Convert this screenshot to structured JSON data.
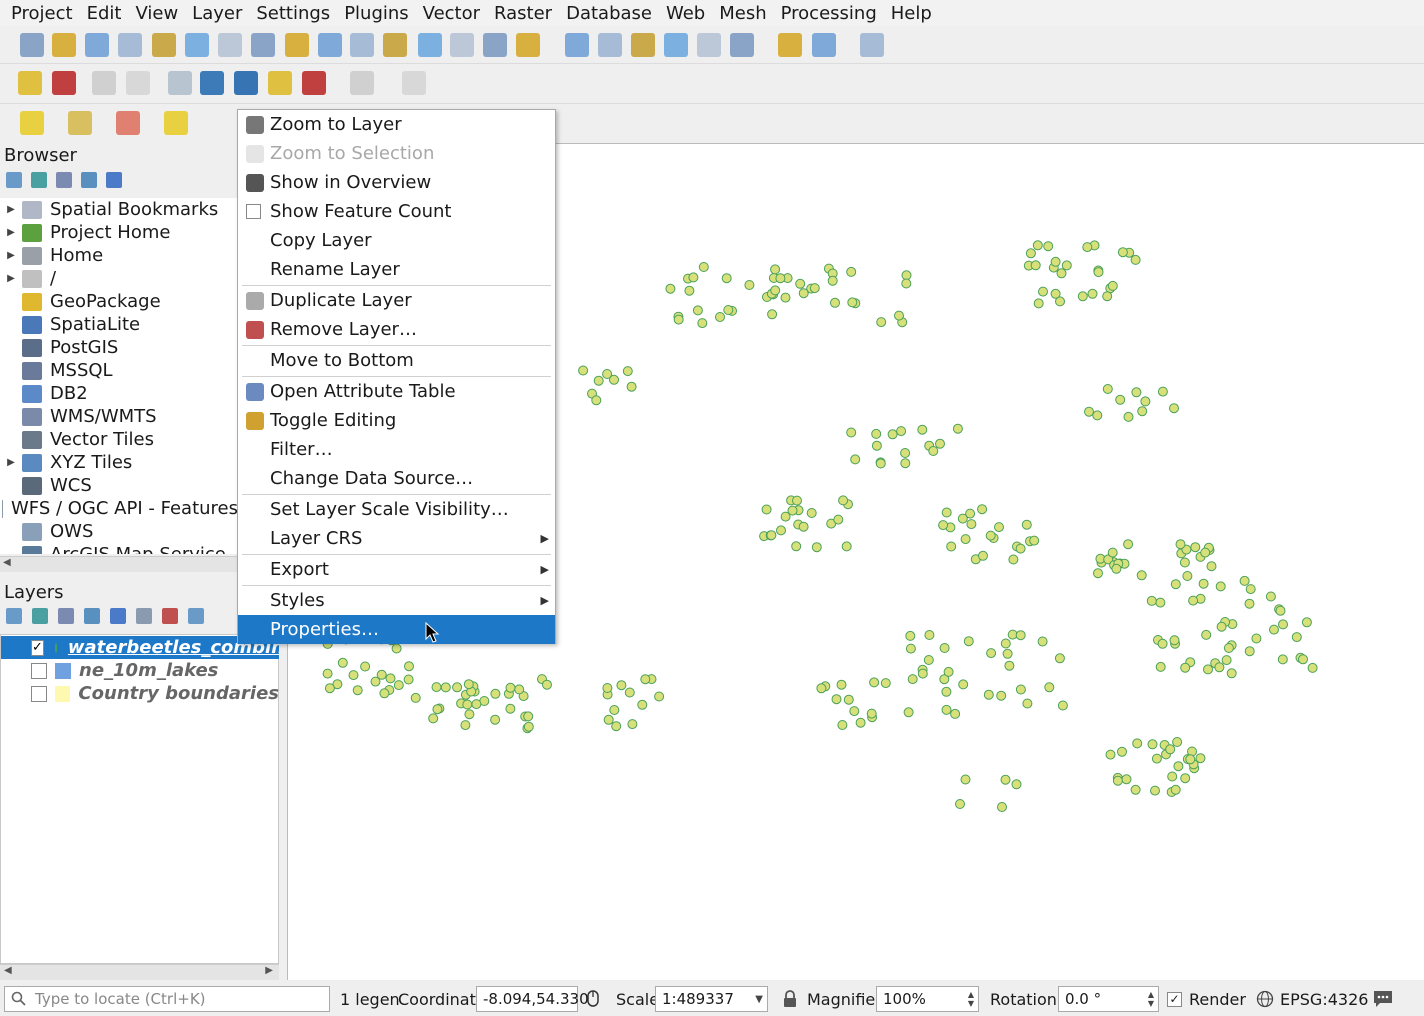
{
  "menubar": [
    "Project",
    "Edit",
    "View",
    "Layer",
    "Settings",
    "Plugins",
    "Vector",
    "Raster",
    "Database",
    "Web",
    "Mesh",
    "Processing",
    "Help"
  ],
  "browser": {
    "title": "Browser",
    "items": [
      {
        "label": "Spatial Bookmarks",
        "icon": "bookmark-icon",
        "expand": true
      },
      {
        "label": "Project Home",
        "icon": "project-home-icon",
        "expand": true
      },
      {
        "label": "Home",
        "icon": "home-icon",
        "expand": true
      },
      {
        "label": "/",
        "icon": "folder-icon",
        "expand": true
      },
      {
        "label": "GeoPackage",
        "icon": "geopackage-icon",
        "expand": false
      },
      {
        "label": "SpatiaLite",
        "icon": "spatialite-icon",
        "expand": false
      },
      {
        "label": "PostGIS",
        "icon": "postgis-icon",
        "expand": false
      },
      {
        "label": "MSSQL",
        "icon": "mssql-icon",
        "expand": false
      },
      {
        "label": "DB2",
        "icon": "db2-icon",
        "expand": false
      },
      {
        "label": "WMS/WMTS",
        "icon": "wms-icon",
        "expand": false
      },
      {
        "label": "Vector Tiles",
        "icon": "vector-tiles-icon",
        "expand": false
      },
      {
        "label": "XYZ Tiles",
        "icon": "xyz-tiles-icon",
        "expand": true
      },
      {
        "label": "WCS",
        "icon": "wcs-icon",
        "expand": false
      },
      {
        "label": "WFS / OGC API - Features",
        "icon": "wfs-icon",
        "expand": false
      },
      {
        "label": "OWS",
        "icon": "ows-icon",
        "expand": false
      },
      {
        "label": "ArcGIS Map Service",
        "icon": "arcgis-icon",
        "expand": false
      }
    ]
  },
  "layers": {
    "title": "Layers",
    "items": [
      {
        "label": "waterbeetles_combin...",
        "checked": true,
        "selected": true,
        "color": "#d8e07a"
      },
      {
        "label": "ne_10m_lakes",
        "checked": false,
        "selected": false,
        "color": "#6fa0e0"
      },
      {
        "label": "Country boundaries",
        "checked": false,
        "selected": false,
        "color": "#fff8b0"
      }
    ]
  },
  "context_menu": {
    "items": [
      {
        "label": "Zoom to Layer",
        "icon": "zoom-layer-icon",
        "disabled": false
      },
      {
        "label": "Zoom to Selection",
        "icon": "zoom-selection-icon",
        "disabled": true
      },
      {
        "label": "Show in Overview",
        "icon": "overview-icon",
        "disabled": false
      },
      {
        "label": "Show Feature Count",
        "icon": "checkbox-icon",
        "disabled": false
      },
      {
        "label": "Copy Layer",
        "icon": "",
        "disabled": false
      },
      {
        "label": "Rename Layer",
        "icon": "",
        "disabled": false
      },
      {
        "sep": true
      },
      {
        "label": "Duplicate Layer",
        "icon": "duplicate-icon",
        "disabled": false
      },
      {
        "label": "Remove Layer…",
        "icon": "remove-icon",
        "disabled": false
      },
      {
        "sep": true
      },
      {
        "label": "Move to Bottom",
        "icon": "",
        "disabled": false
      },
      {
        "sep": true
      },
      {
        "label": "Open Attribute Table",
        "icon": "attribute-table-icon",
        "disabled": false
      },
      {
        "label": "Toggle Editing",
        "icon": "pencil-icon",
        "disabled": false
      },
      {
        "label": "Filter…",
        "icon": "",
        "disabled": false
      },
      {
        "label": "Change Data Source…",
        "icon": "",
        "disabled": false
      },
      {
        "sep": true
      },
      {
        "label": "Set Layer Scale Visibility…",
        "icon": "",
        "disabled": false
      },
      {
        "label": "Layer CRS",
        "icon": "",
        "disabled": false,
        "submenu": true
      },
      {
        "sep": true
      },
      {
        "label": "Export",
        "icon": "",
        "disabled": false,
        "submenu": true
      },
      {
        "sep": true
      },
      {
        "label": "Styles",
        "icon": "",
        "disabled": false,
        "submenu": true
      },
      {
        "label": "Properties…",
        "icon": "",
        "disabled": false,
        "highlighted": true
      }
    ]
  },
  "statusbar": {
    "locator_placeholder": "Type to locate (Ctrl+K)",
    "legend_text": "1 legen",
    "coordinate_label": "Coordinate",
    "coordinate_value": "-8.094,54.330",
    "scale_label": "Scale",
    "scale_value": "1:489337",
    "magnifier_label": "Magnifier",
    "magnifier_value": "100%",
    "rotation_label": "Rotation",
    "rotation_value": "0.0 °",
    "render_label": "Render",
    "render_checked": true,
    "crs": "EPSG:4326"
  },
  "colors": {
    "point_fill": "#d8e07a",
    "point_stroke": "#4aa05a",
    "selection": "#1e78c8"
  }
}
